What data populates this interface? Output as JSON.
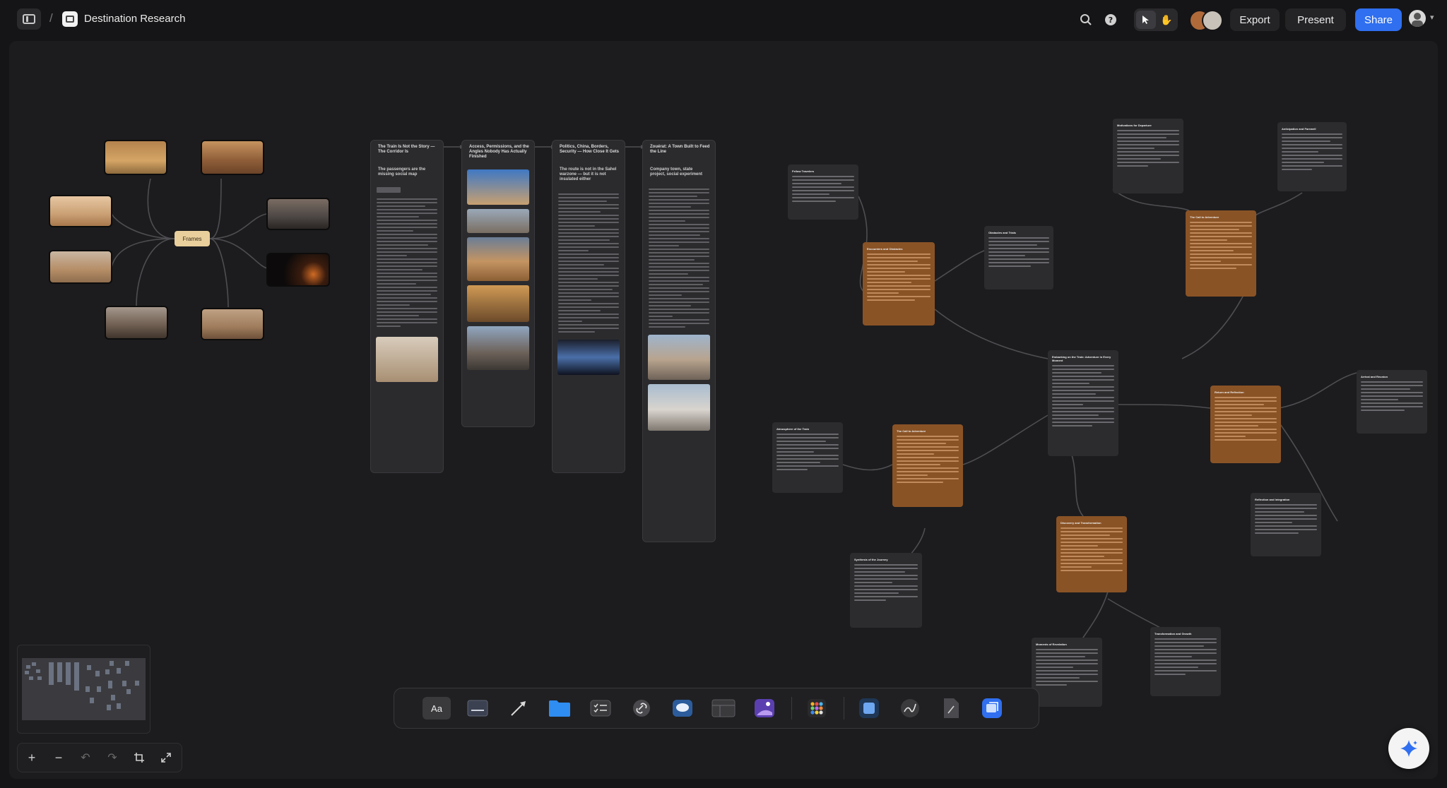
{
  "header": {
    "board_title": "Destination Research",
    "export_label": "Export",
    "present_label": "Present",
    "share_label": "Share"
  },
  "mindmap": {
    "center_label": "Frames"
  },
  "columns": [
    {
      "title": "The Train Is Not the Story — The Corridor Is",
      "subtitle": "The passengers are the missing social map"
    },
    {
      "title": "Access, Permissions, and the Angles Nobody Has Actually Finished",
      "subtitle": ""
    },
    {
      "title": "Politics, China, Borders, Security — How Close It Gets",
      "subtitle": "The route is not in the Sahel warzone — but it is not insulated either"
    },
    {
      "title": "Zouérat: A Town Built to Feed the Line",
      "subtitle": "Company town, state project, social experiment"
    }
  ],
  "cards": {
    "fellow_travelers": "Fellow Travelers",
    "encounters": "Encounters and Obstacles",
    "obstacles_trials": "Obstacles and Trials",
    "atmosphere": "Atmosphere of the Train",
    "call_to_adventure_a": "The Call to Adventure",
    "embarking": "Embarking on the Train: Adventure in Every Moment",
    "synthesis": "Synthesis of the Journey",
    "discovery": "Discovery and Transformation",
    "moments_revelation": "Moments of Revelation",
    "transformation_growth": "Transformation and Growth",
    "motivations": "Motivations for Departure",
    "anticipation": "Anticipation and Farewell",
    "call_to_adventure_b": "The Call to Adventure",
    "return_reflection": "Return and Reflection",
    "arrival": "Arrival and Reunion",
    "reflection": "Reflection and Integration"
  },
  "dock": {
    "text_tool_label": "Aa"
  },
  "colors": {
    "accent": "#2f6ff0",
    "canvas_bg": "#1c1c1e",
    "note_brown": "#8a5326",
    "frames_node": "#e9cf9c"
  },
  "icons": [
    "sidebar-toggle-icon",
    "board-icon",
    "search-icon",
    "help-icon",
    "cursor-icon",
    "hand-icon",
    "zoom-in-icon",
    "zoom-out-icon",
    "undo-icon",
    "redo-icon",
    "frame-icon",
    "fullscreen-icon",
    "ai-sparkle-icon"
  ]
}
